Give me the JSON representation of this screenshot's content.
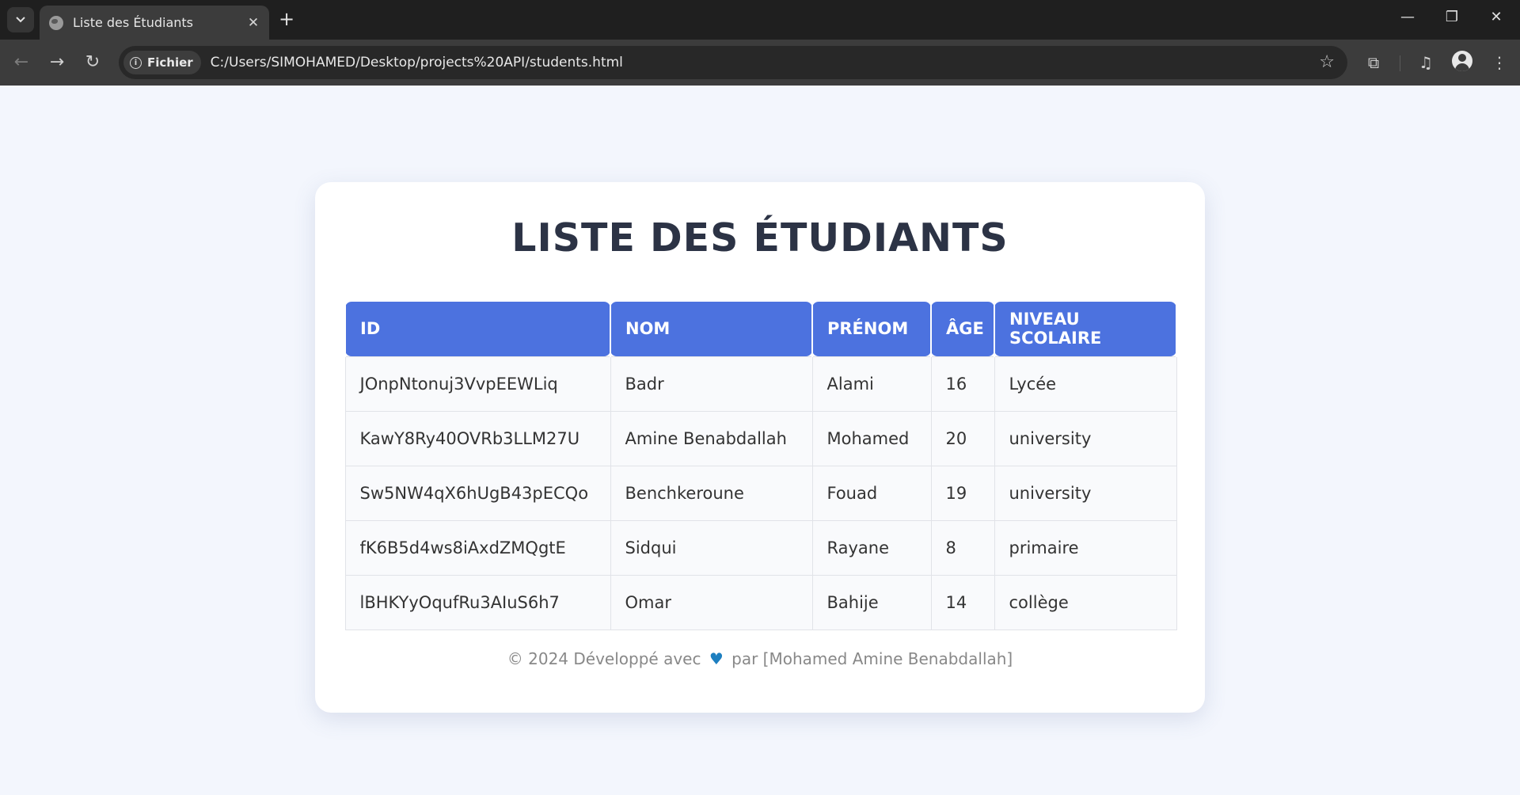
{
  "browser": {
    "tab_title": "Liste des Étudiants",
    "site_chip": "Fichier",
    "url": "C:/Users/SIMOHAMED/Desktop/projects%20API/students.html"
  },
  "page": {
    "title": "LISTE DES ÉTUDIANTS",
    "table": {
      "headers": [
        "ID",
        "NOM",
        "PRÉNOM",
        "ÂGE",
        "NIVEAU SCOLAIRE"
      ],
      "rows": [
        [
          "JOnpNtonuj3VvpEEWLiq",
          "Badr",
          "Alami",
          "16",
          "Lycée"
        ],
        [
          "KawY8Ry40OVRb3LLM27U",
          "Amine Benabdallah",
          "Mohamed",
          "20",
          "university"
        ],
        [
          "Sw5NW4qX6hUgB43pECQo",
          "Benchkeroune",
          "Fouad",
          "19",
          "university"
        ],
        [
          "fK6B5d4ws8iAxdZMQgtE",
          "Sidqui",
          "Rayane",
          "8",
          "primaire"
        ],
        [
          "lBHKYyOqufRu3AIuS6h7",
          "Omar",
          "Bahije",
          "14",
          "collège"
        ]
      ]
    },
    "footer": {
      "before": "© 2024 Développé avec",
      "after": "par [Mohamed Amine Benabdallah]"
    }
  },
  "colors": {
    "header_bg": "#4c72df",
    "page_bg": "#f3f6fd",
    "heart": "#1d7fc0"
  }
}
